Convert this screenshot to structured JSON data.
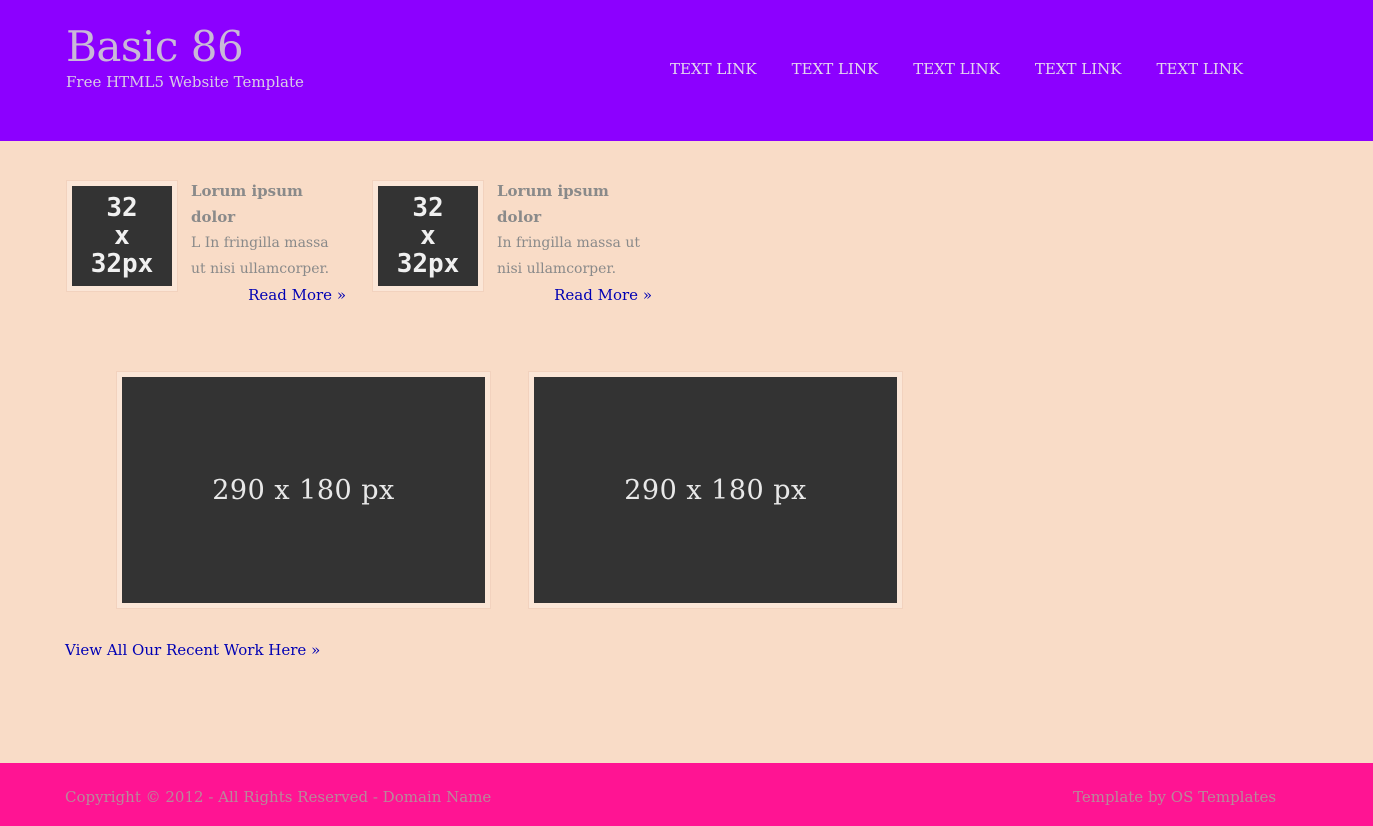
{
  "header": {
    "title": "Basic 86",
    "tagline": "Free HTML5 Website Template",
    "nav": [
      "TEXT LINK",
      "TEXT LINK",
      "TEXT LINK",
      "TEXT LINK",
      "TEXT LINK"
    ]
  },
  "features": [
    {
      "thumb_lines": [
        "32",
        "x",
        "32px"
      ],
      "title": "Lorum ipsum dolor",
      "text": "L In fringilla massa ut nisi ullamcorper.",
      "link": "Read More »"
    },
    {
      "thumb_lines": [
        "32",
        "x",
        "32px"
      ],
      "title": "Lorum ipsum dolor",
      "text": "In fringilla massa ut nisi ullamcorper.",
      "link": "Read More »"
    }
  ],
  "gallery": [
    {
      "label": "290 x 180 px"
    },
    {
      "label": "290 x 180 px"
    }
  ],
  "view_all_link": "View All Our Recent Work Here »",
  "footer": {
    "copyright": "Copyright © 2012 - All Rights Reserved - Domain Name",
    "credit": "Template by OS Templates"
  },
  "colors": {
    "header_bg": "#8c00ff",
    "page_bg": "#f9dcc7",
    "footer_bg": "#ff1493",
    "link": "#0000b4",
    "placeholder_bg": "#333333"
  }
}
